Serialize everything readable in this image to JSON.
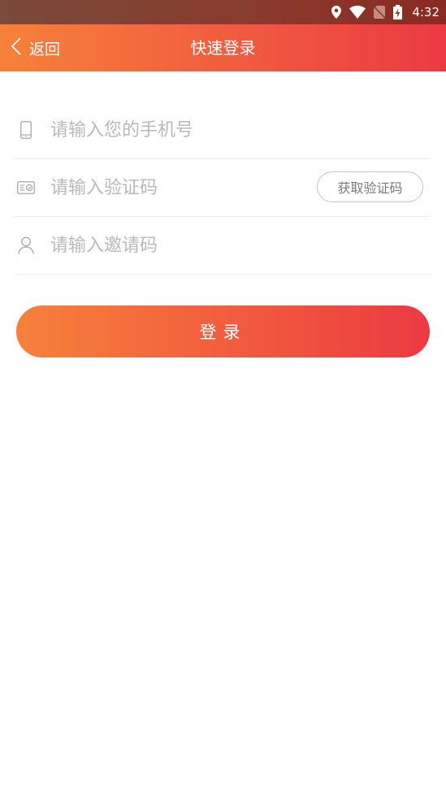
{
  "status_bar": {
    "time": "4:32",
    "icons": [
      "location-icon",
      "wifi-icon",
      "no-sim-icon",
      "battery-charging-icon"
    ]
  },
  "nav": {
    "back_label": "返回",
    "title": "快速登录",
    "back_icon": "chevron-left-icon"
  },
  "form": {
    "phone": {
      "placeholder": "请输入您的手机号",
      "value": "",
      "icon": "phone-icon"
    },
    "code": {
      "placeholder": "请输入验证码",
      "value": "",
      "icon": "verification-card-icon",
      "get_code_label": "获取验证码"
    },
    "invite": {
      "placeholder": "请输入邀请码",
      "value": "",
      "icon": "user-icon"
    }
  },
  "login_button": {
    "label": "登录"
  },
  "colors": {
    "gradient_start": "#f6813a",
    "gradient_end": "#ec3a43",
    "placeholder": "#b9b9b9",
    "divider": "#ececec"
  }
}
